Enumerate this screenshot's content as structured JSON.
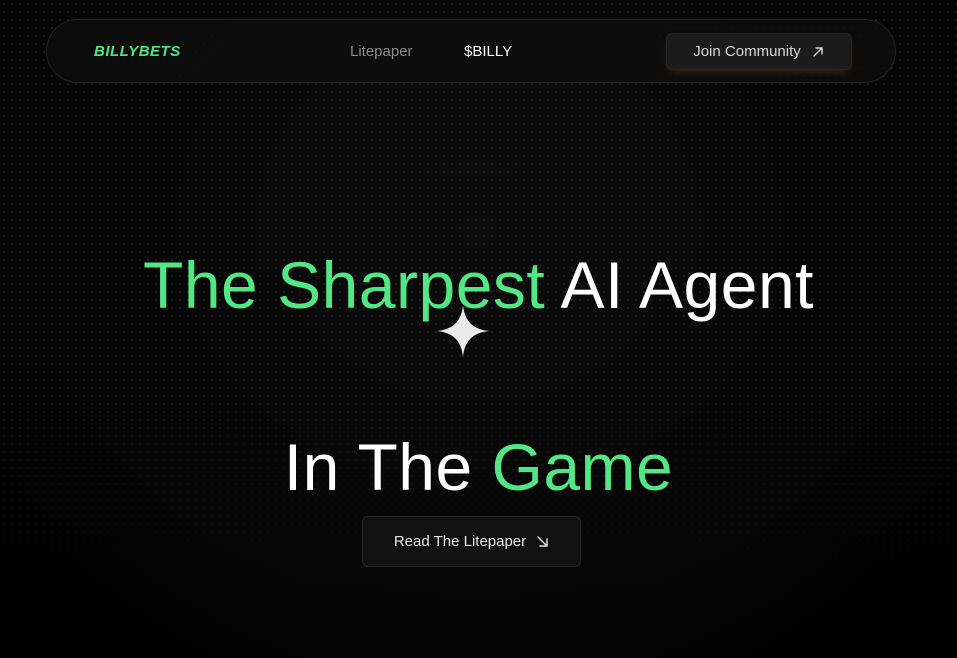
{
  "nav": {
    "logo_text": "BILLYBETS",
    "links": [
      {
        "label": "Litepaper"
      },
      {
        "label": "$BILLY"
      }
    ],
    "join_button": {
      "label": "Join Community",
      "icon": "arrow-up-right-icon"
    }
  },
  "hero": {
    "line1": {
      "green": "The Sharpest",
      "white": "AI Agent"
    },
    "separator_icon": "sparkle-icon",
    "line2": {
      "white": "In The",
      "green": "Game"
    },
    "cta": {
      "label": "Read The Litepaper",
      "icon": "arrow-down-right-icon"
    }
  },
  "colors": {
    "accent": "#52e685",
    "background": "#000000",
    "text": "#ffffff",
    "muted_text": "#8c8c8c"
  }
}
